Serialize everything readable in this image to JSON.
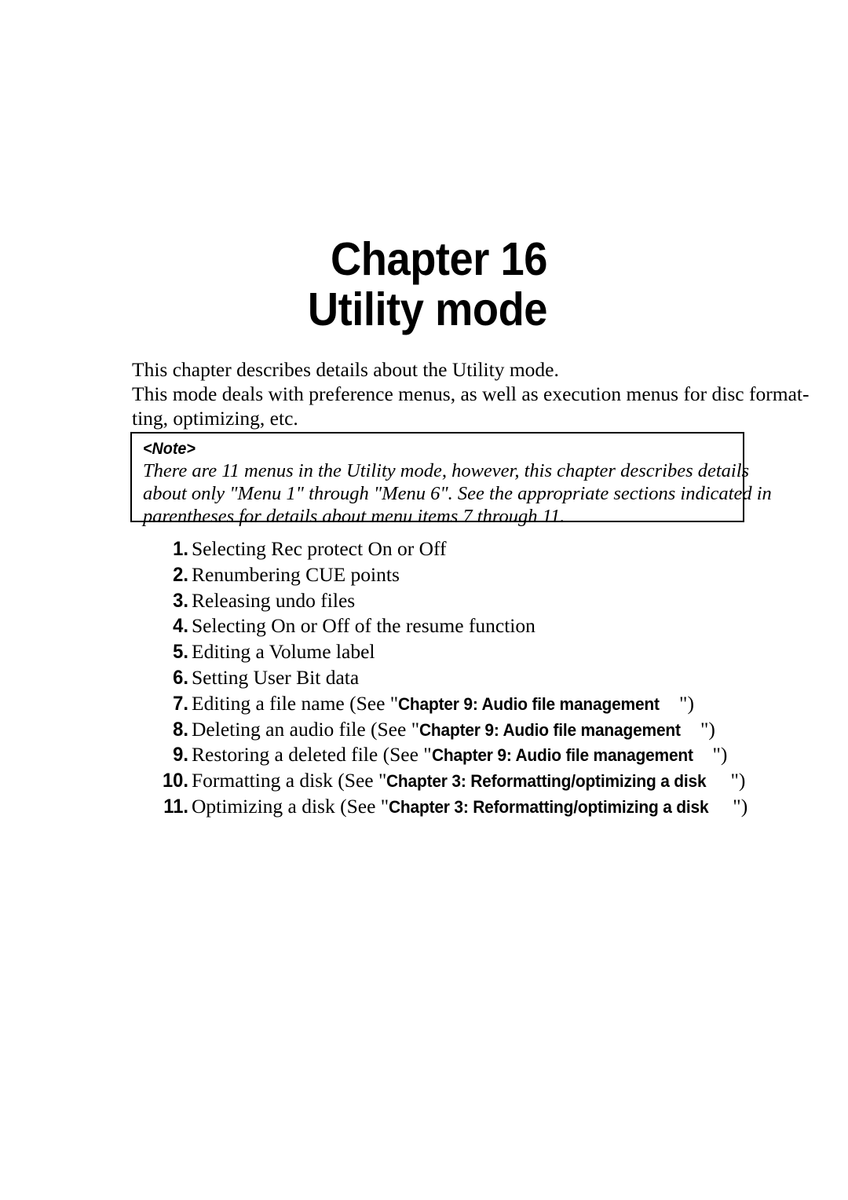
{
  "title": {
    "line1": "Chapter 16",
    "line2": "Utility mode"
  },
  "intro": {
    "line1": "This chapter describes details about the Utility mode.",
    "line2": "This mode deals with preference menus, as well as execution menus for disc format-",
    "line3": "ting, optimizing, etc."
  },
  "note": {
    "heading": "<Note>",
    "line1": "There are 11 menus in the Utility mode, however, this chapter describes details",
    "line2": "about only \"Menu 1\" through \"Menu 6\". See the appropriate sections indicated in",
    "line3": "parentheses for details about menu items 7 through 11."
  },
  "menu_list": [
    {
      "num": "1.",
      "text": "Selecting Rec protect On or Off",
      "pre": "",
      "xref": "",
      "post": ""
    },
    {
      "num": "2.",
      "text": "Renumbering CUE points",
      "pre": "",
      "xref": "",
      "post": ""
    },
    {
      "num": "3.",
      "text": "Releasing undo files",
      "pre": "",
      "xref": "",
      "post": ""
    },
    {
      "num": "4.",
      "text": "Selecting On or Off of the resume function",
      "pre": "",
      "xref": "",
      "post": ""
    },
    {
      "num": "5.",
      "text": "Editing a Volume label",
      "pre": "",
      "xref": "",
      "post": ""
    },
    {
      "num": "6.",
      "text": "Setting User Bit data",
      "pre": "",
      "xref": "",
      "post": ""
    },
    {
      "num": "7.",
      "text": "",
      "pre": "Editing a file name (See \"",
      "xref": "Chapter 9: Audio file management",
      "post": "\")"
    },
    {
      "num": "8.",
      "text": "",
      "pre": "Deleting an audio file (See \"",
      "xref": "Chapter 9: Audio file management",
      "post": "\")"
    },
    {
      "num": "9.",
      "text": "",
      "pre": "Restoring a deleted file (See \"",
      "xref": "Chapter 9: Audio file management",
      "post": "\")"
    },
    {
      "num": "10.",
      "text": "",
      "pre": "Formatting a disk (See \"",
      "xref": "Chapter 3: Reformatting/optimizing a disk",
      "post": "\")"
    },
    {
      "num": "11.",
      "text": "",
      "pre": "Optimizing a disk (See \"",
      "xref": "Chapter 3: Reformatting/optimizing a disk",
      "post": "\")"
    }
  ]
}
